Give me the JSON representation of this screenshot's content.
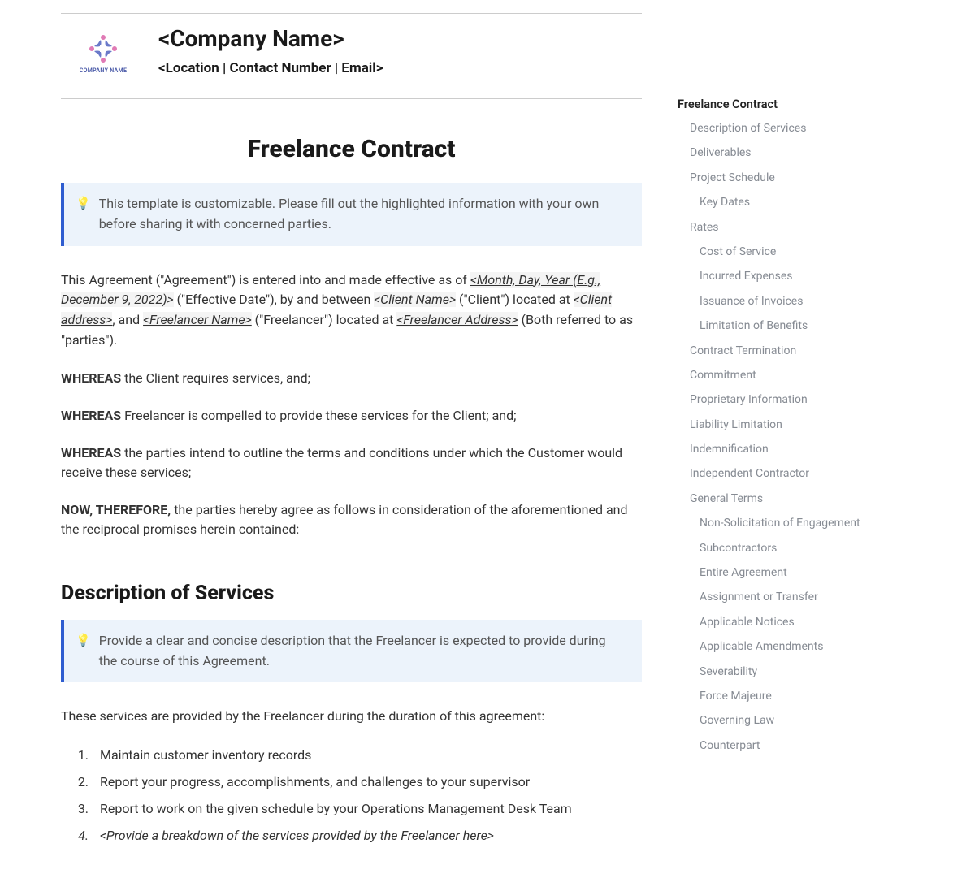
{
  "header": {
    "company_name": "<Company Name>",
    "subtitle": "<Location | Contact Number | Email>",
    "logo_text": "COMPANY NAME"
  },
  "title": "Freelance Contract",
  "callout1": {
    "text": "This template is customizable. Please fill out the highlighted information with your own before sharing it with concerned parties."
  },
  "agreement_intro": {
    "pre1": "This Agreement (\"Agreement\") is entered into and made effective as of ",
    "date_ph": "<Month, Day, Year (E.g., December 9, 2022)>",
    "mid1": " (\"Effective Date\"), by and between ",
    "client_ph": "<Client Name>",
    "mid2": " (\"Client\") located at ",
    "client_addr_ph": "<Client address>",
    "mid3": ", and ",
    "freelancer_ph": "<Freelancer Name>",
    "mid4": " (\"Freelancer\") located at ",
    "freelancer_addr_ph": "<Freelancer Address>",
    "post": " (Both referred to as \"parties\")."
  },
  "whereas": [
    {
      "bold": "WHEREAS",
      "text": " the Client requires services, and;"
    },
    {
      "bold": "WHEREAS",
      "text": " Freelancer is compelled to provide these services for the Client; and;"
    },
    {
      "bold": "WHEREAS",
      "text": " the parties intend to outline the terms and conditions under which the Customer would receive these services;"
    },
    {
      "bold": "NOW, THEREFORE,",
      "text": " the parties hereby agree as follows in consideration of the aforementioned and the reciprocal promises herein contained:"
    }
  ],
  "section_desc": {
    "title": "Description of Services",
    "callout": "Provide a clear and concise description that the Freelancer is expected to provide during the course of this Agreement.",
    "lead": "These services are provided by the Freelancer during the duration of this agreement:",
    "items": [
      "Maintain customer inventory records",
      "Report your progress, accomplishments, and challenges to your supervisor",
      "Report to work on the given schedule by your Operations Management Desk Team",
      "<Provide a breakdown of the services provided by the Freelancer here>"
    ]
  },
  "toc": {
    "title": "Freelance Contract",
    "items": [
      {
        "label": "Description of Services"
      },
      {
        "label": "Deliverables"
      },
      {
        "label": "Project Schedule",
        "sub": [
          "Key Dates"
        ]
      },
      {
        "label": "Rates",
        "sub": [
          "Cost of Service",
          "Incurred Expenses",
          "Issuance of Invoices",
          "Limitation of Benefits"
        ]
      },
      {
        "label": "Contract Termination"
      },
      {
        "label": "Commitment"
      },
      {
        "label": "Proprietary Information"
      },
      {
        "label": "Liability Limitation"
      },
      {
        "label": "Indemnification"
      },
      {
        "label": "Independent Contractor"
      },
      {
        "label": "General Terms",
        "sub": [
          "Non-Solicitation of Engagement",
          "Subcontractors",
          "Entire Agreement",
          "Assignment or Transfer",
          "Applicable Notices",
          "Applicable Amendments",
          "Severability",
          "Force Majeure",
          "Governing Law",
          "Counterpart"
        ]
      }
    ]
  }
}
